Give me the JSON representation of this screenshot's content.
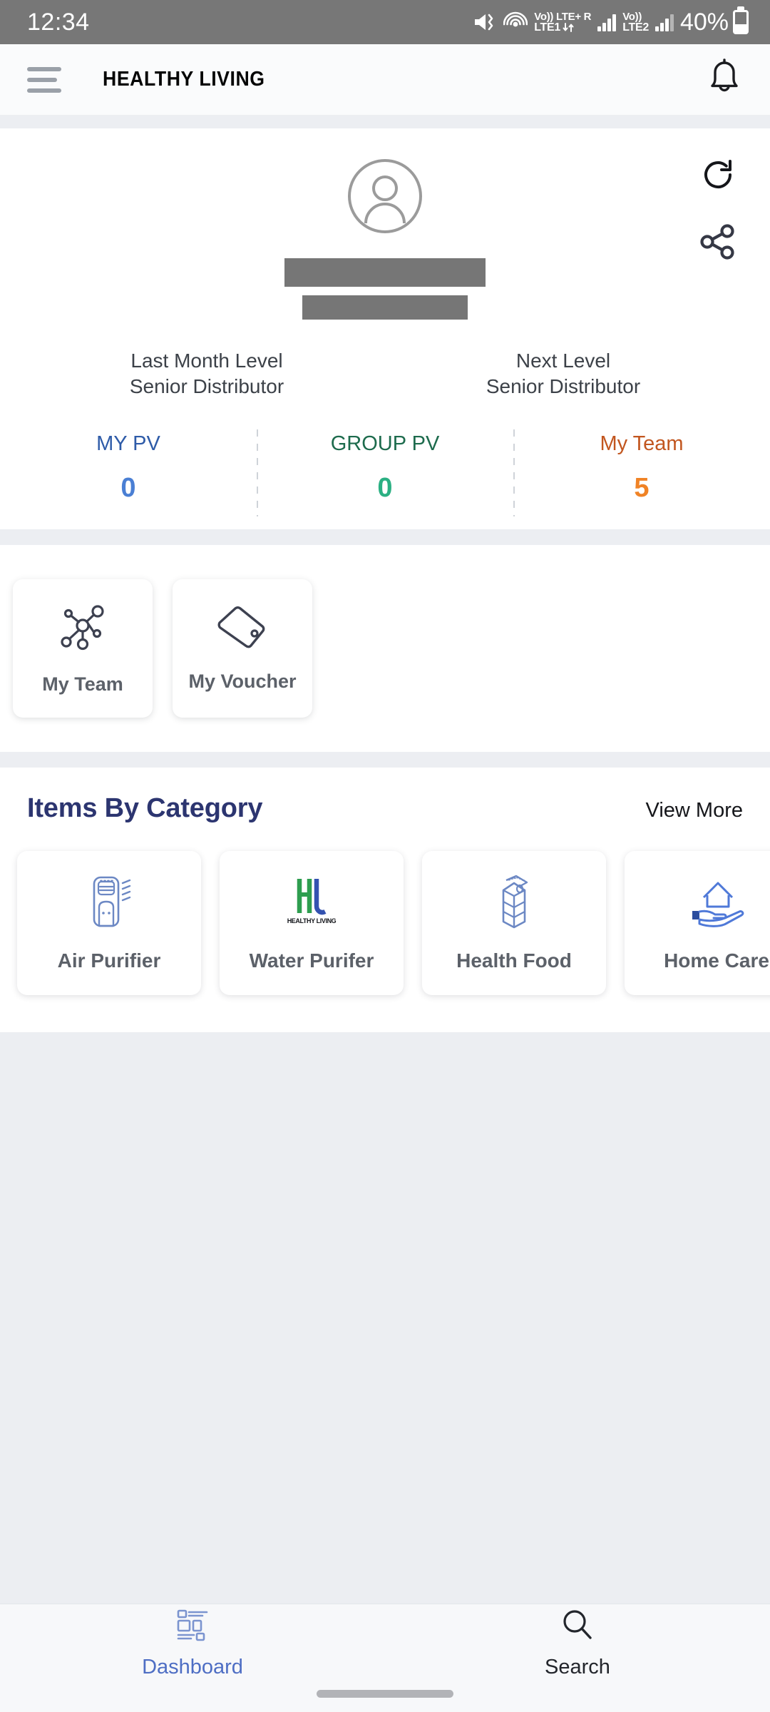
{
  "status_bar": {
    "time": "12:34",
    "icons": [
      "vibrate-icon",
      "hotspot-icon",
      "volte-sim1-icon",
      "signal-sim1-icon",
      "volte-sim2-icon",
      "signal-sim2-icon"
    ],
    "sim1": {
      "top": "Vo))",
      "bottom": "LTE1",
      "network": "LTE+",
      "roaming": "R"
    },
    "sim2": {
      "top": "Vo))",
      "bottom": "LTE2"
    },
    "battery_percent": "40%"
  },
  "app_bar": {
    "menu_icon": "hamburger-menu-icon",
    "title": "HEALTHY LIVING",
    "notification_icon": "bell-icon"
  },
  "profile": {
    "avatar_icon": "user-avatar-icon",
    "refresh_icon": "refresh-icon",
    "share_icon": "share-icon",
    "name_redacted": "",
    "id_redacted": "",
    "levels": [
      {
        "caption": "Last Month Level",
        "value": "Senior Distributor"
      },
      {
        "caption": "Next Level",
        "value": "Senior Distributor"
      }
    ],
    "stats": [
      {
        "label": "MY PV",
        "value": "0",
        "label_color": "#2e5ba8",
        "value_color": "#4a7fd4"
      },
      {
        "label": "GROUP PV",
        "value": "0",
        "label_color": "#1d6b4d",
        "value_color": "#2bb083"
      },
      {
        "label": "My Team",
        "value": "5",
        "label_color": "#c2561f",
        "value_color": "#f08326"
      }
    ]
  },
  "quick_actions": [
    {
      "label": "My Team",
      "icon": "network-nodes-icon"
    },
    {
      "label": "My Voucher",
      "icon": "price-tag-icon"
    }
  ],
  "categories_section": {
    "title": "Items By Category",
    "view_more": "View More",
    "items": [
      {
        "label": "Air Purifier",
        "icon": "air-purifier-icon"
      },
      {
        "label": "Water Purifer",
        "icon": "hl-logo-icon"
      },
      {
        "label": "Health Food",
        "icon": "milk-carton-icon"
      },
      {
        "label": "Home Care",
        "icon": "house-in-hand-icon"
      }
    ]
  },
  "bottom_nav": [
    {
      "label": "Dashboard",
      "icon": "dashboard-grid-icon",
      "active": true
    },
    {
      "label": "Search",
      "icon": "magnifier-icon",
      "active": false
    }
  ],
  "colors": {
    "status_bar_bg": "#777777",
    "page_bg": "#eceef2",
    "accent_navy": "#2c3570",
    "nav_active": "#4e6ec4",
    "icon_blue": "#6c88c4"
  }
}
